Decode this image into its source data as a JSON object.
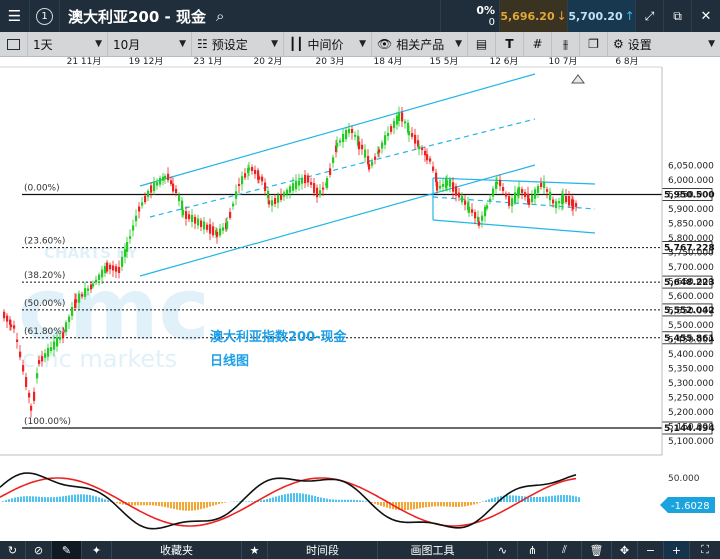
{
  "window": {
    "index_badge": "1",
    "title": "澳大利亚200 - 现金",
    "change_pct": "0%",
    "change_val": "0",
    "sell_price": "5,696.20",
    "buy_price": "5,700.20"
  },
  "toolbar": {
    "interval": "1天",
    "range": "10月",
    "preset": "预设定",
    "midprice": "中间价",
    "related": "相关产品",
    "settings": "设置"
  },
  "chart": {
    "x_labels": [
      "21 11月",
      "19 12月",
      "23 1月",
      "20 2月",
      "20 3月",
      "18 4月",
      "15 5月",
      "12 6月",
      "10 7月",
      "6 8月"
    ],
    "y_labels": [
      "6,050.000",
      "6,000.000",
      "5,950.000",
      "5,900.000",
      "5,850.000",
      "5,800.000",
      "5,750.000",
      "5,700.000",
      "5,650.000",
      "5,600.000",
      "5,550.000",
      "5,500.000",
      "5,450.000",
      "5,400.000",
      "5,350.000",
      "5,300.000",
      "5,250.000",
      "5,200.000",
      "5,150.000",
      "5,100.000"
    ],
    "fib_levels": [
      {
        "label": "(0.00%)",
        "value": "5,950.500"
      },
      {
        "label": "(23.60%)",
        "value": "5,767.228"
      },
      {
        "label": "(38.20%)",
        "value": "5,648.223"
      },
      {
        "label": "(50.00%)",
        "value": "5,552.042"
      },
      {
        "label": "(61.80%)",
        "value": "5,455.861"
      },
      {
        "label": "(100.00%)",
        "value": "5,144.494"
      }
    ],
    "watermark_small": "CHARTS BY",
    "watermark_big": "cmc",
    "watermark_sub": "cmc markets",
    "annotation_line1": "澳大利亚指数200-现金",
    "annotation_line2": "日线图",
    "osc_label": "50.000",
    "osc_value": "-1.6028"
  },
  "bottom": {
    "favorites": "收藏夹",
    "timeframe": "时间段",
    "drawing_tools": "画图工具"
  },
  "colors": {
    "up": "#22cc22",
    "down": "#ee2222",
    "channel": "#22b6e8",
    "dark": "#1f2e3a",
    "buy": "#1e9be0",
    "sell": "#e5a12b"
  }
}
